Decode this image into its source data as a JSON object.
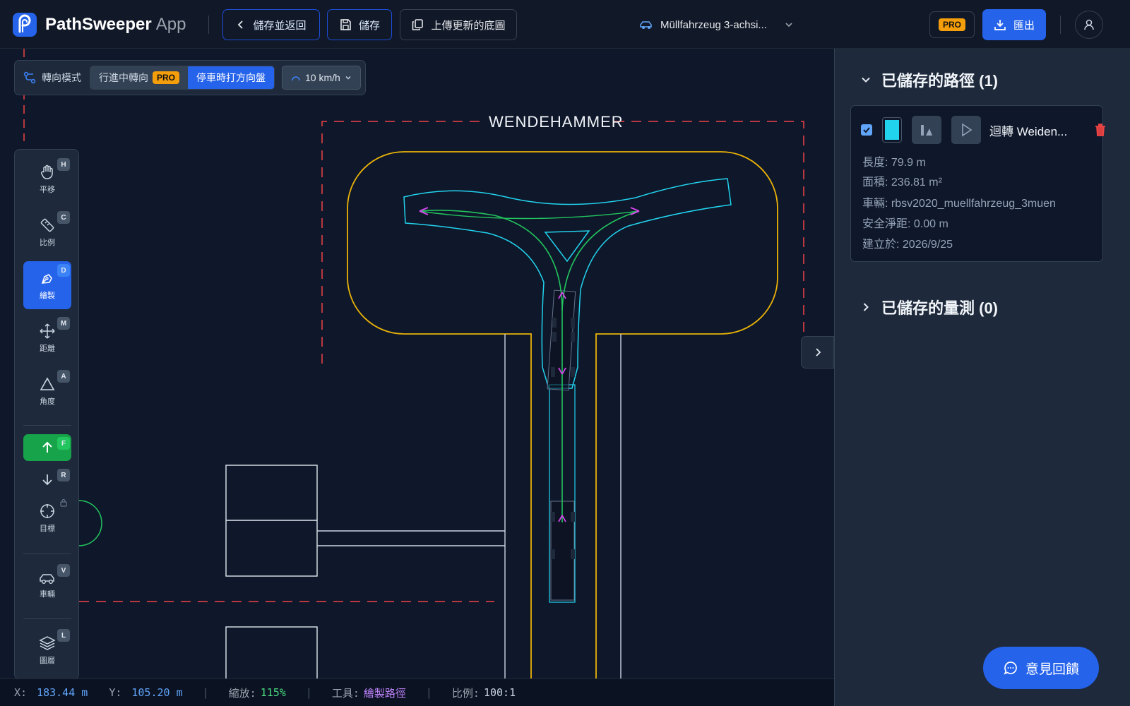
{
  "app": {
    "name": "PathSweeper",
    "suffix": "App"
  },
  "header": {
    "save_back": "儲存並返回",
    "save": "儲存",
    "upload": "上傳更新的底圖",
    "vehicle": "Müllfahrzeug 3-achsi...",
    "pro": "PRO",
    "export": "匯出"
  },
  "mode_bar": {
    "label": "轉向模式",
    "option_moving": "行進中轉向",
    "option_moving_badge": "PRO",
    "option_standstill": "停車時打方向盤",
    "speed": "10 km/h"
  },
  "tools": [
    {
      "label": "平移",
      "key": "H",
      "icon": "hand-icon"
    },
    {
      "label": "比例",
      "key": "C",
      "icon": "ruler-icon"
    },
    {
      "label": "繪製",
      "key": "D",
      "icon": "pen-icon"
    },
    {
      "label": "距離",
      "key": "M",
      "icon": "move-icon"
    },
    {
      "label": "角度",
      "key": "A",
      "icon": "triangle-icon"
    },
    {
      "label": "",
      "key": "F",
      "icon": "arrow-up-icon"
    },
    {
      "label": "",
      "key": "R",
      "icon": "arrow-down-icon"
    },
    {
      "label": "目標",
      "key": "",
      "icon": "crosshair-icon"
    },
    {
      "label": "車輛",
      "key": "V",
      "icon": "car-icon"
    },
    {
      "label": "圖層",
      "key": "L",
      "icon": "layers-icon"
    }
  ],
  "drawing": {
    "label": "WENDEHAMMER"
  },
  "status": {
    "x_label": "X:",
    "x_value": "183.44 m",
    "y_label": "Y:",
    "y_value": "105.20 m",
    "zoom_label": "縮放:",
    "zoom_value": "115%",
    "tool_label": "工具:",
    "tool_value": "繪製路徑",
    "scale_label": "比例:",
    "scale_value": "100:1"
  },
  "panel": {
    "routes_title": "已儲存的路徑 (1)",
    "route": {
      "name": "迴轉 Weiden...",
      "color": "#22d3ee",
      "length": "長度: 79.9 m",
      "area": "面積: 236.81 m²",
      "vehicle": "車輛: rbsv2020_muellfahrzeug_3muen",
      "clearance": "安全淨距: 0.00 m",
      "created": "建立於: 2026/9/25"
    },
    "measures_title": "已儲存的量測 (0)"
  },
  "feedback": "意見回饋"
}
